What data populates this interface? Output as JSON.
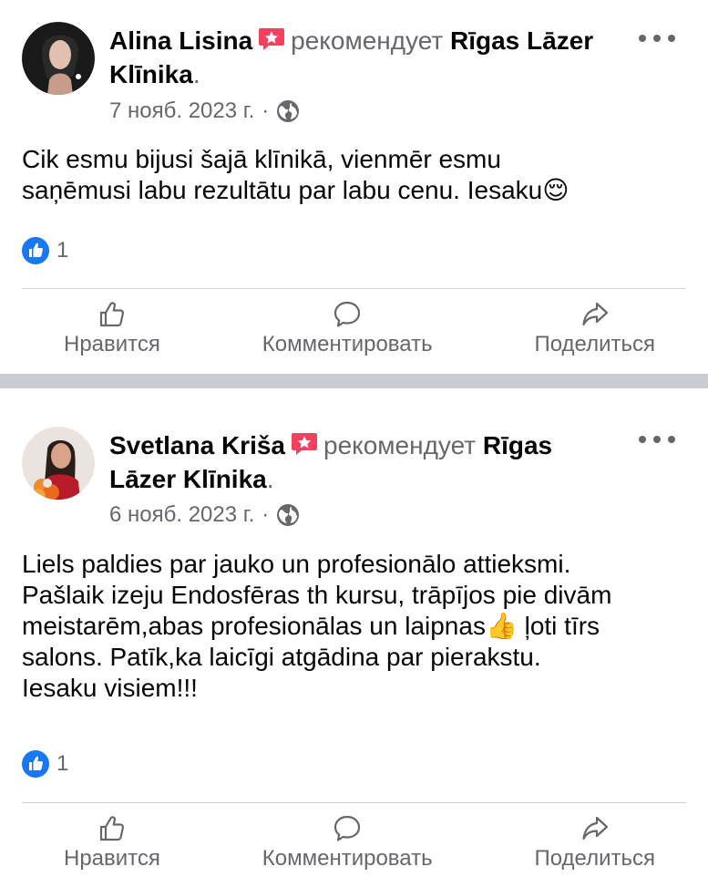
{
  "posts": [
    {
      "author": "Alina Lisina",
      "verb": "рекомендует",
      "page": "Rīgas Lāzer Klīnika",
      "period": ".",
      "date": "7 нояб. 2023 г.",
      "separator": "·",
      "text": "Cik esmu bijusi šajā klīnikā, vienmēr esmu\nsaņēmusi labu rezultātu par labu cenu. Iesaku😌",
      "likes": "1"
    },
    {
      "author": "Svetlana Kriša",
      "verb": "рекомендует",
      "page": "Rīgas Lāzer Klīnika",
      "period": ".",
      "date": "6 нояб. 2023 г.",
      "separator": "·",
      "text": "Liels paldies par jauko un profesionālo attieksmi.\nPašlaik izeju Endosfēras th kursu, trāpījos pie divām\nmeistarēm,abas profesionālas un laipnas👍 ļoti tīrs\nsalons. Patīk,ka laicīgi atgādina par pierakstu.\nIesaku visiem!!!",
      "likes": "1"
    }
  ],
  "actions": {
    "like": "Нравится",
    "comment": "Комментировать",
    "share": "Поделиться"
  },
  "icons": {
    "recommend": "recommend-badge-icon",
    "globe": "globe-icon",
    "more": "more-options-icon",
    "like_reaction": "like-reaction-icon",
    "like": "thumbs-up-icon",
    "comment": "comment-icon",
    "share": "share-icon"
  },
  "colors": {
    "like_blue": "#1877f2",
    "recommend_red": "#f3425f",
    "secondary_text": "#65676b"
  }
}
